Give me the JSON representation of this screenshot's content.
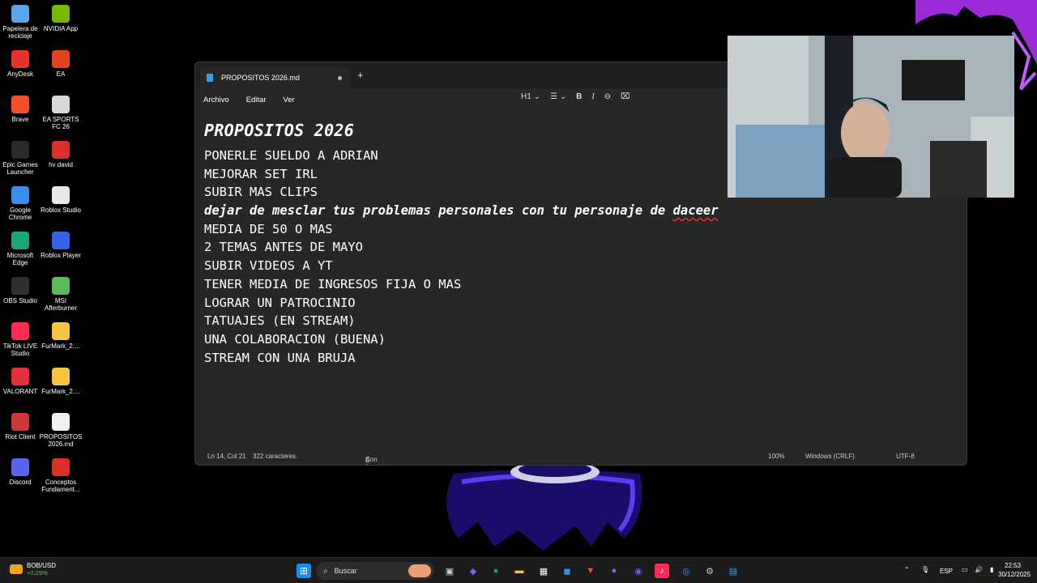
{
  "desktop_icons": [
    {
      "label": "Papelera de reciclaje",
      "icon": "recycle-bin-icon",
      "color": "#5aa6e8"
    },
    {
      "label": "NVIDIA App",
      "icon": "nvidia-icon",
      "color": "#76b900"
    },
    {
      "label": "AnyDesk",
      "icon": "anydesk-icon",
      "color": "#e8322c"
    },
    {
      "label": "EA",
      "icon": "ea-icon",
      "color": "#e4411e"
    },
    {
      "label": "Brave",
      "icon": "brave-icon",
      "color": "#f2502c"
    },
    {
      "label": "EA SPORTS FC 26",
      "icon": "ea-fc-icon",
      "color": "#d8d8d8"
    },
    {
      "label": "Epic Games Launcher",
      "icon": "epic-games-icon",
      "color": "#2a2a2a"
    },
    {
      "label": "hv david",
      "icon": "pdf-icon",
      "color": "#d9302c"
    },
    {
      "label": "Google Chrome",
      "icon": "chrome-icon",
      "color": "#3b8fe8"
    },
    {
      "label": "Roblox Studio",
      "icon": "roblox-studio-icon",
      "color": "#e8e8e8"
    },
    {
      "label": "Microsoft Edge",
      "icon": "edge-icon",
      "color": "#1aa67a"
    },
    {
      "label": "Roblox Player",
      "icon": "roblox-player-icon",
      "color": "#3462e8"
    },
    {
      "label": "OBS Studio",
      "icon": "obs-icon",
      "color": "#303030"
    },
    {
      "label": "MSI Afterburner",
      "icon": "msi-afterburner-icon",
      "color": "#5cb85c"
    },
    {
      "label": "TikTok LIVE Studio",
      "icon": "tiktok-live-icon",
      "color": "#fe2c55"
    },
    {
      "label": "FurMark_2....",
      "icon": "folder-icon",
      "color": "#f5c542"
    },
    {
      "label": "VALORANT",
      "icon": "valorant-icon",
      "color": "#e3303a"
    },
    {
      "label": "FurMark_2....",
      "icon": "folder-icon",
      "color": "#f5c542"
    },
    {
      "label": "Riot Client",
      "icon": "riot-client-icon",
      "color": "#d13639"
    },
    {
      "label": "PROPOSITOS 2026.md",
      "icon": "file-icon",
      "color": "#f0f0f0"
    },
    {
      "label": "Discord",
      "icon": "discord-icon",
      "color": "#5865f2"
    },
    {
      "label": "Conceptos Fundament...",
      "icon": "pdf-icon",
      "color": "#d9302c"
    }
  ],
  "notepad": {
    "tab_title": "PROPOSITOS 2026.md",
    "new_tab": "+",
    "menu": [
      "Archivo",
      "Editar",
      "Ver"
    ],
    "format_toolbar": {
      "heading": "H1",
      "bold": "B",
      "italic": "I"
    },
    "doc_title": "PROPOSITOS 2026",
    "lines": [
      "PONERLE SUELDO A ADRIAN",
      "MEJORAR SET IRL",
      "SUBIR MAS CLIPS",
      "dejar de mesclar tus problemas personales con tu personaje de ",
      "MEDIA DE 50 O MAS",
      "2 TEMAS ANTES DE MAYO",
      "SUBIR VIDEOS A YT",
      "TENER MEDIA DE INGRESOS FIJA O MAS",
      "LOGRAR UN PATROCINIO",
      "TATUAJES (EN STREAM)",
      "UNA COLABORACION (BUENA)",
      "STREAM CON UNA BRUJA"
    ],
    "misspelled_word": "daceer",
    "status": {
      "position": "Ln 14, Col 21",
      "chars": "322 caracteres.",
      "format": "Con formato",
      "zoom": "100%",
      "line_ending": "Windows (CRLF)",
      "encoding": "UTF-8"
    }
  },
  "taskbar": {
    "ticker_name": "BOB/USD",
    "ticker_change": "+0,29%",
    "search_label": "Buscar",
    "language": "ESP",
    "time": "22:53",
    "date": "30/12/2025"
  }
}
